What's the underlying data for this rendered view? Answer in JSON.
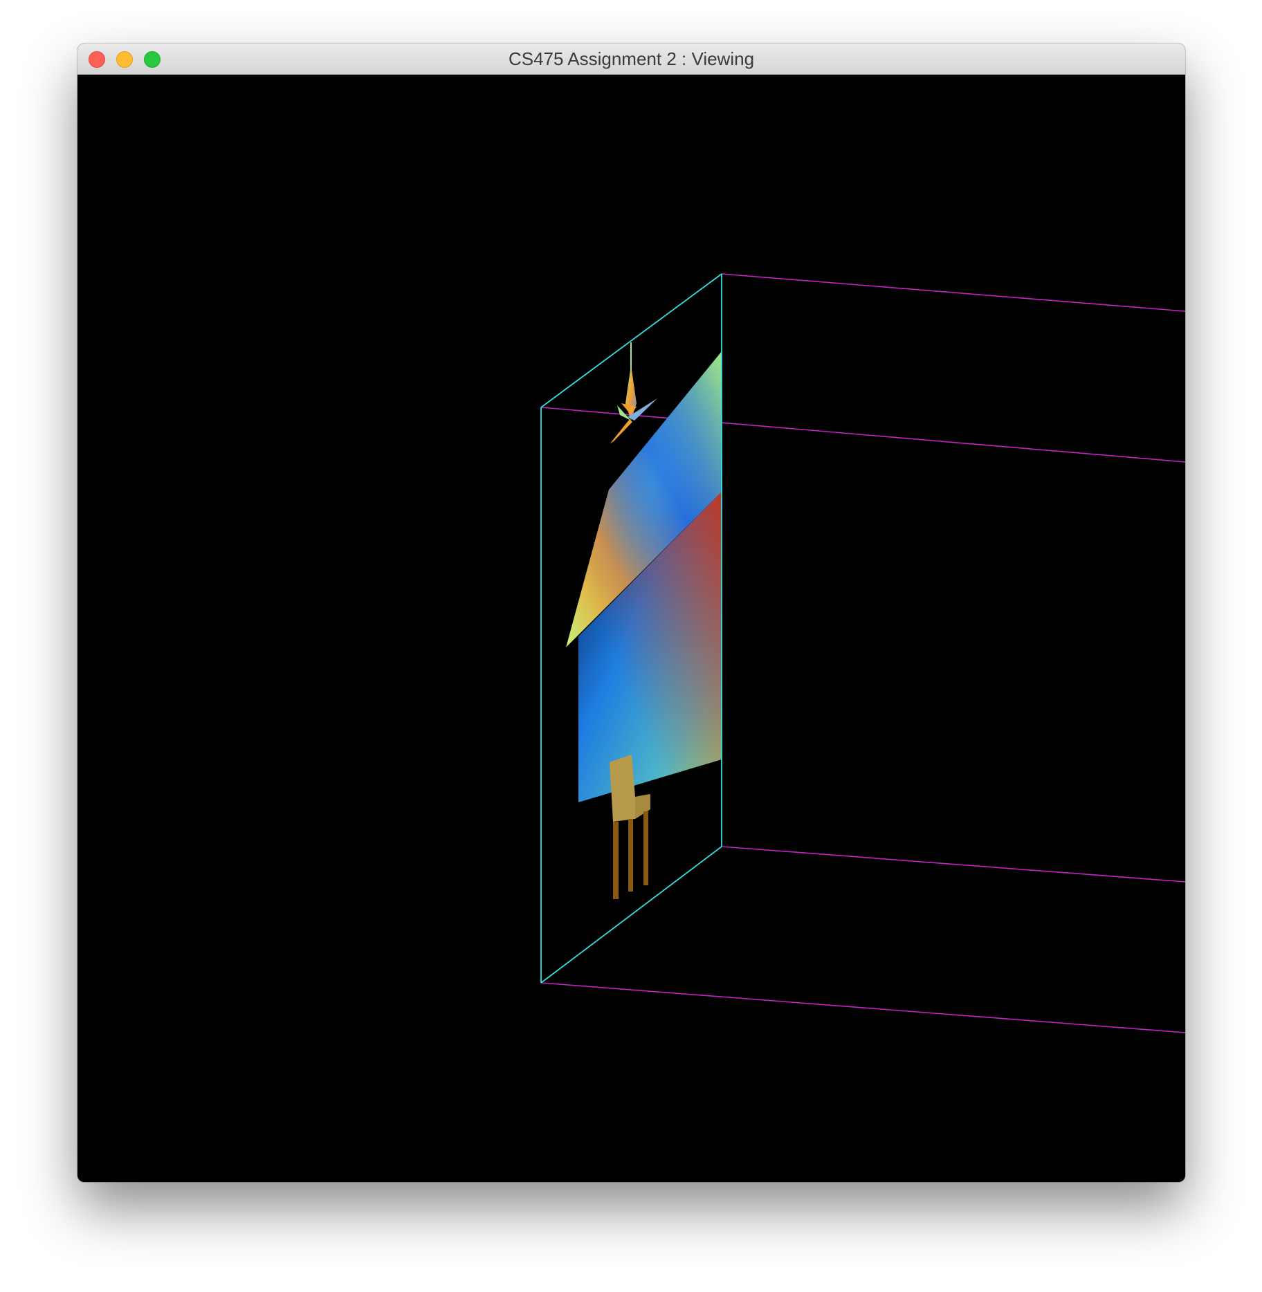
{
  "window": {
    "title": "CS475 Assignment 2 : Viewing",
    "buttons": [
      "close",
      "minimize",
      "zoom"
    ]
  },
  "scene": {
    "background_color": "#000000",
    "frustum_near_color": "#33e0e0",
    "frustum_far_color": "#c424c4",
    "objects": [
      "hanging-lamp",
      "wall-panel",
      "chair"
    ],
    "palette": {
      "orange": "#f08a24",
      "blue": "#1a4fd6",
      "light_green": "#9ee889",
      "red": "#c0392b",
      "chair_seat": "#b89a4c",
      "chair_legs": "#8b5a12"
    }
  }
}
